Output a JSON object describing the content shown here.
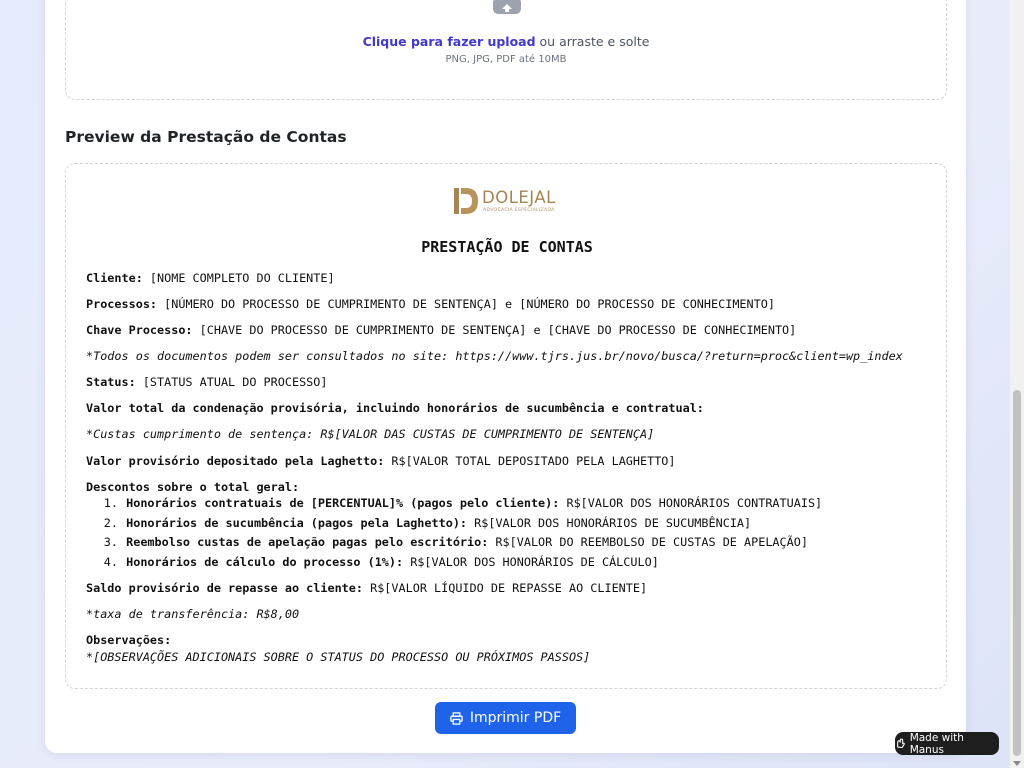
{
  "upload": {
    "link_text": "Clique para fazer upload",
    "rest_text": " ou arraste e solte",
    "hint": "PNG, JPG, PDF até 10MB",
    "icon": "cloud-upload-icon"
  },
  "preview": {
    "section_title": "Preview da Prestação de Contas",
    "logo": {
      "name": "DOLEJAL",
      "subtitle": "ADVOCACIA ESPECIALIZADA",
      "brand_color": "#a88450"
    },
    "doc_title": "PRESTAÇÃO DE CONTAS",
    "cliente_label": "Cliente:",
    "cliente_value": " [NOME COMPLETO DO CLIENTE]",
    "processos_label": "Processos:",
    "processos_value": " [NÚMERO DO PROCESSO DE CUMPRIMENTO DE SENTENÇA] e [NÚMERO DO PROCESSO DE CONHECIMENTO]",
    "chave_label": "Chave Processo:",
    "chave_value": " [CHAVE DO PROCESSO DE CUMPRIMENTO DE SENTENÇA] e [CHAVE DO PROCESSO DE CONHECIMENTO]",
    "consulta_note": "*Todos os documentos podem ser consultados no site: https://www.tjrs.jus.br/novo/busca/?return=proc&client=wp_index",
    "status_label": "Status:",
    "status_value": " [STATUS ATUAL DO PROCESSO]",
    "valor_total_label": "Valor total da condenação provisória, incluindo honorários de sucumbência e contratual:",
    "custas_note": "*Custas cumprimento de sentença: R$[VALOR DAS CUSTAS DE CUMPRIMENTO DE SENTENÇA]",
    "depositado_label": "Valor provisório depositado pela Laghetto:",
    "depositado_value": " R$[VALOR TOTAL DEPOSITADO PELA LAGHETTO]",
    "descontos_label": "Descontos sobre o total geral:",
    "descontos": [
      {
        "num": "1.",
        "label": "Honorários contratuais de [PERCENTUAL]% (pagos pelo cliente):",
        "value": " R$[VALOR DOS HONORÁRIOS CONTRATUAIS]"
      },
      {
        "num": "2.",
        "label": "Honorários de sucumbência (pagos pela Laghetto):",
        "value": " R$[VALOR DOS HONORÁRIOS DE SUCUMBÊNCIA]"
      },
      {
        "num": "3.",
        "label": "Reembolso custas de apelação pagas pelo escritório:",
        "value": " R$[VALOR DO REEMBOLSO DE CUSTAS DE APELAÇÃO]"
      },
      {
        "num": "4.",
        "label": "Honorários de cálculo do processo (1%):",
        "value": " R$[VALOR DOS HONORÁRIOS DE CÁLCULO]"
      }
    ],
    "saldo_label": "Saldo provisório de repasse ao cliente:",
    "saldo_value": " R$[VALOR LÍQUIDO DE REPASSE AO CLIENTE]",
    "taxa_note": "*taxa de transferência: R$8,00",
    "observacoes_label": "Observações:",
    "observacoes_value": "*[OBSERVAÇÕES ADICIONAIS SOBRE O STATUS DO PROCESSO OU PRÓXIMOS PASSOS]"
  },
  "print_button": {
    "label": "Imprimir PDF",
    "icon": "printer-icon",
    "color": "#1f63ea"
  },
  "badge": {
    "label": "Made with Manus",
    "icon": "manus-icon"
  }
}
